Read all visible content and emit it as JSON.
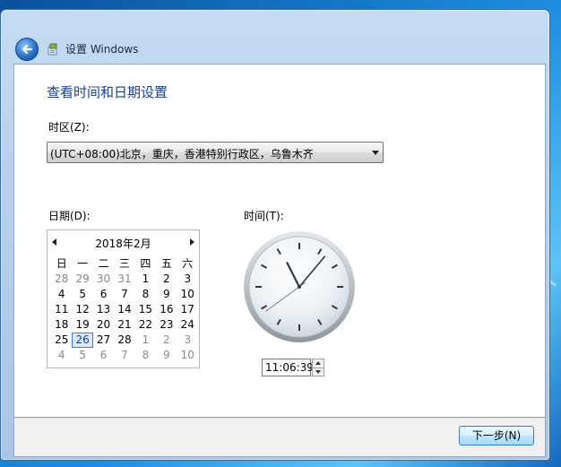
{
  "window": {
    "title": "设置 Windows"
  },
  "page": {
    "title": "查看时间和日期设置"
  },
  "timezone": {
    "label": "时区(Z):",
    "selected": "(UTC+08:00)北京，重庆，香港特别行政区，乌鲁木齐"
  },
  "date": {
    "label": "日期(D):",
    "month_label": "2018年2月",
    "weekdays": [
      "日",
      "一",
      "二",
      "三",
      "四",
      "五",
      "六"
    ],
    "days": [
      {
        "d": "28",
        "dim": true
      },
      {
        "d": "29",
        "dim": true
      },
      {
        "d": "30",
        "dim": true
      },
      {
        "d": "31",
        "dim": true
      },
      {
        "d": "1"
      },
      {
        "d": "2"
      },
      {
        "d": "3"
      },
      {
        "d": "4"
      },
      {
        "d": "5"
      },
      {
        "d": "6"
      },
      {
        "d": "7"
      },
      {
        "d": "8"
      },
      {
        "d": "9"
      },
      {
        "d": "10"
      },
      {
        "d": "11"
      },
      {
        "d": "12"
      },
      {
        "d": "13"
      },
      {
        "d": "14"
      },
      {
        "d": "15"
      },
      {
        "d": "16"
      },
      {
        "d": "17"
      },
      {
        "d": "18"
      },
      {
        "d": "19"
      },
      {
        "d": "20"
      },
      {
        "d": "21"
      },
      {
        "d": "22"
      },
      {
        "d": "23"
      },
      {
        "d": "24"
      },
      {
        "d": "25"
      },
      {
        "d": "26",
        "selected": true
      },
      {
        "d": "27"
      },
      {
        "d": "28"
      },
      {
        "d": "1",
        "dim": true
      },
      {
        "d": "2",
        "dim": true
      },
      {
        "d": "3",
        "dim": true
      },
      {
        "d": "4",
        "dim": true
      },
      {
        "d": "5",
        "dim": true
      },
      {
        "d": "6",
        "dim": true
      },
      {
        "d": "7",
        "dim": true
      },
      {
        "d": "8",
        "dim": true
      },
      {
        "d": "9",
        "dim": true
      },
      {
        "d": "10",
        "dim": true
      }
    ]
  },
  "time": {
    "label": "时间(T):",
    "value": "11:06:39",
    "hour": 11,
    "minute": 6,
    "second": 39
  },
  "footer": {
    "next_label": "下一步(N)"
  },
  "colors": {
    "title_blue": "#1e3f8a",
    "selection": "#3a7bd5"
  }
}
